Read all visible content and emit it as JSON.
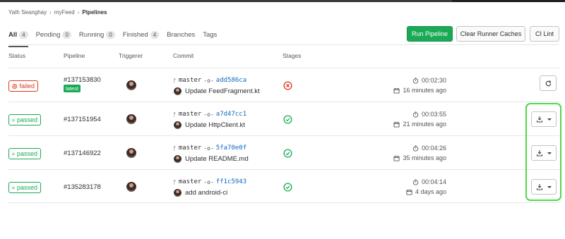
{
  "breadcrumb": {
    "user": "Yath Seanghay",
    "project": "myFeed",
    "current": "Pipelines"
  },
  "tabs": [
    {
      "label": "All",
      "count": "4",
      "active": true
    },
    {
      "label": "Pending",
      "count": "0"
    },
    {
      "label": "Running",
      "count": "0"
    },
    {
      "label": "Finished",
      "count": "4"
    },
    {
      "label": "Branches",
      "count": null
    },
    {
      "label": "Tags",
      "count": null
    }
  ],
  "buttons": {
    "run_pipeline": "Run Pipeline",
    "clear_caches": "Clear Runner Caches",
    "ci_lint": "CI Lint"
  },
  "columns": {
    "status": "Status",
    "pipeline": "Pipeline",
    "triggerer": "Triggerer",
    "commit": "Commit",
    "stages": "Stages"
  },
  "rows": [
    {
      "status": "failed",
      "pipeline_id": "#137153830",
      "latest_label": "latest",
      "branch": "master",
      "sha": "add586ca",
      "message": "Update FeedFragment.kt",
      "stage": "failed",
      "duration": "00:02:30",
      "finished": "16 minutes ago",
      "action": "retry"
    },
    {
      "status": "passed",
      "pipeline_id": "#137151954",
      "branch": "master",
      "sha": "a7d47cc1",
      "message": "Update HttpClient.kt",
      "stage": "passed",
      "duration": "00:03:55",
      "finished": "21 minutes ago",
      "action": "download"
    },
    {
      "status": "passed",
      "pipeline_id": "#137146922",
      "branch": "master",
      "sha": "5fa70e0f",
      "message": "Update README.md",
      "stage": "passed",
      "duration": "00:04:26",
      "finished": "35 minutes ago",
      "action": "download"
    },
    {
      "status": "passed",
      "pipeline_id": "#135283178",
      "branch": "master",
      "sha": "ff1c5943",
      "message": "add android-ci",
      "stage": "passed",
      "duration": "00:04:14",
      "finished": "4 days ago",
      "action": "download"
    }
  ],
  "colors": {
    "success": "#1aaa55",
    "danger": "#db3b21",
    "link": "#1068bf",
    "highlight": "#4ed94e"
  },
  "icons": {
    "failed": "x-circle-icon",
    "passed": "check-circle-icon",
    "duration": "timer-icon",
    "finished": "calendar-icon",
    "retry": "retry-icon",
    "download": "download-icon"
  }
}
